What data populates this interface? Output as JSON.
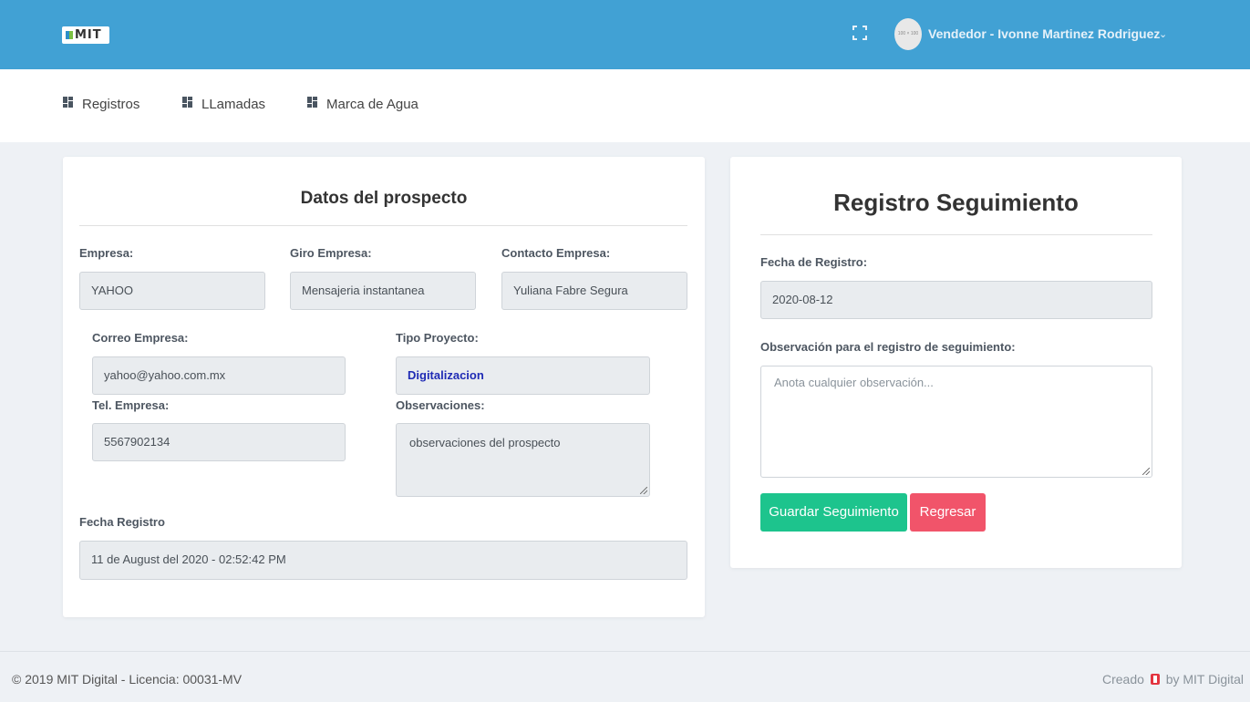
{
  "header": {
    "logo_text": "MIT",
    "avatar_text": "100 × 100",
    "user_label": "Vendedor - Ivonne Martinez Rodriguez",
    "chevron": "⌄"
  },
  "nav": {
    "items": [
      {
        "label": "Registros",
        "icon": "grid-icon"
      },
      {
        "label": "LLamadas",
        "icon": "grid-icon"
      },
      {
        "label": "Marca de Agua",
        "icon": "grid-icon"
      }
    ]
  },
  "prospect": {
    "title": "Datos del prospecto",
    "empresa_label": "Empresa:",
    "empresa_value": "YAHOO",
    "giro_label": "Giro Empresa:",
    "giro_value": "Mensajeria instantanea",
    "contacto_label": "Contacto Empresa:",
    "contacto_value": "Yuliana Fabre Segura",
    "correo_label": "Correo Empresa:",
    "correo_value": "yahoo@yahoo.com.mx",
    "tipo_label": "Tipo Proyecto:",
    "tipo_value": "Digitalizacion",
    "tel_label": "Tel. Empresa:",
    "tel_value": "5567902134",
    "obs_label": "Observaciones:",
    "obs_value": "observaciones del prospecto",
    "fecha_label": "Fecha Registro",
    "fecha_value": "11 de August del 2020 - 02:52:42 PM"
  },
  "seguimiento": {
    "title": "Registro Seguimiento",
    "fecha_label": "Fecha de Registro:",
    "fecha_value": "2020-08-12",
    "obs_label": "Observación para el registro de seguimiento:",
    "obs_placeholder": "Anota cualquier observación...",
    "save_label": "Guardar Seguimiento",
    "back_label": "Regresar"
  },
  "footer": {
    "left_text": "© 2019 MIT Digital - Licencia: 00031-MV",
    "right_prefix": "Creado",
    "right_suffix": "by MIT Digital"
  },
  "colors": {
    "topbar": "#41a1d4",
    "save_button": "#1dc48d",
    "back_button": "#f1546a",
    "tipo_text": "#1f2bb5"
  }
}
